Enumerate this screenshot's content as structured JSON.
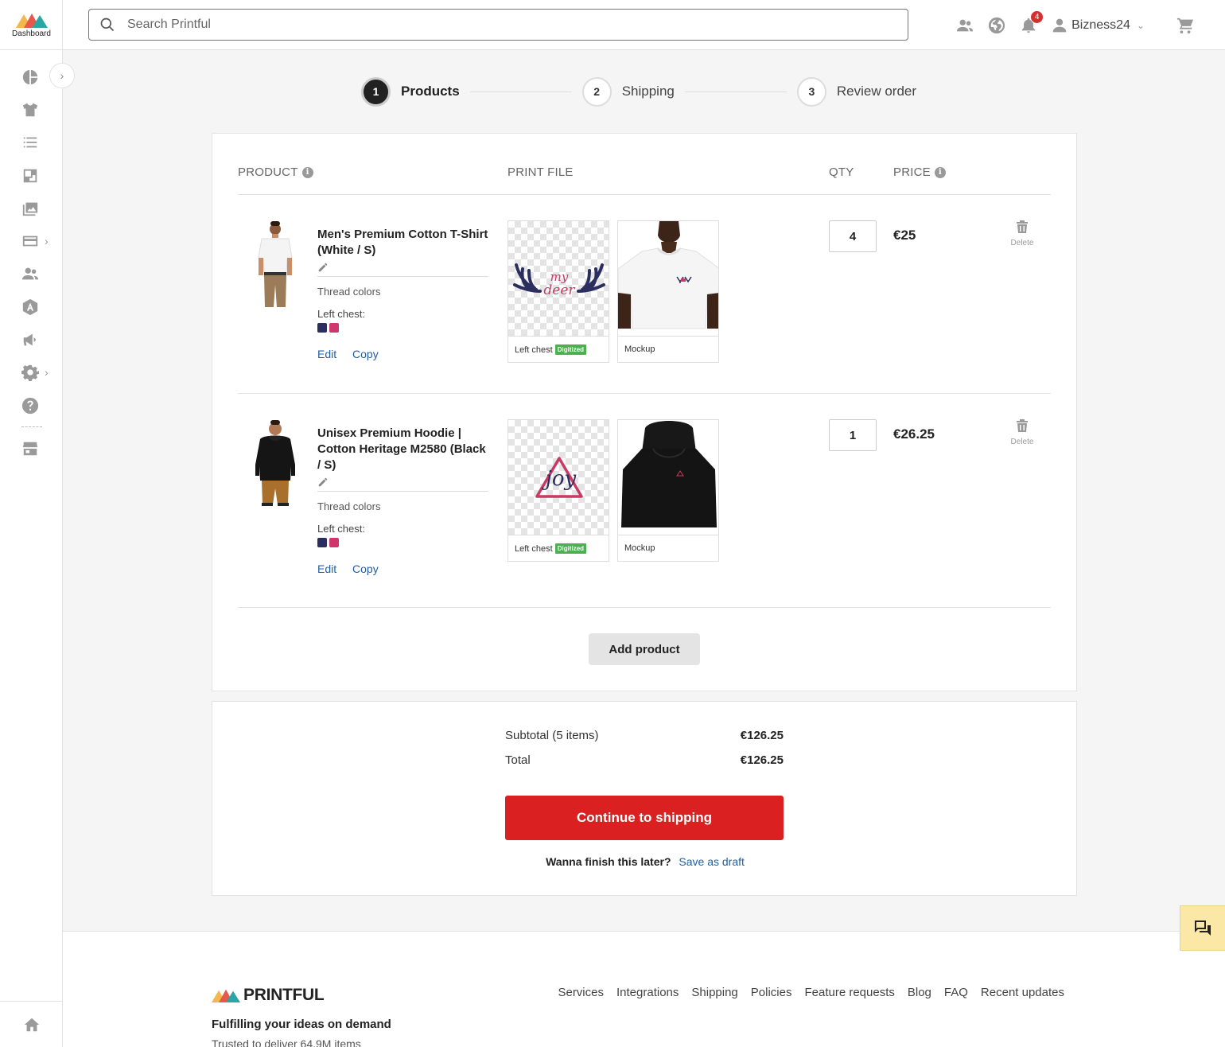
{
  "app": {
    "logo_label": "Dashboard"
  },
  "search": {
    "placeholder": "Search Printful"
  },
  "topbar": {
    "notification_count": "4",
    "user_name": "Bizness24"
  },
  "stepper": {
    "steps": [
      {
        "num": "1",
        "label": "Products"
      },
      {
        "num": "2",
        "label": "Shipping"
      },
      {
        "num": "3",
        "label": "Review order"
      }
    ]
  },
  "table": {
    "headers": {
      "product": "PRODUCT",
      "print_file": "PRINT FILE",
      "qty": "QTY",
      "price": "PRICE"
    }
  },
  "items": [
    {
      "name": "Men's Premium Cotton T-Shirt (White / S)",
      "thread_colors": "Thread colors",
      "placement": "Left chest:",
      "swatches": [
        "#2b2e5e",
        "#d0356b"
      ],
      "edit": "Edit",
      "copy": "Copy",
      "print_caption": "Left chest",
      "digitized": "Digitized",
      "mockup_caption": "Mockup",
      "qty": "4",
      "price": "€25",
      "delete": "Delete"
    },
    {
      "name": "Unisex Premium Hoodie | Cotton Heritage M2580 (Black / S)",
      "thread_colors": "Thread colors",
      "placement": "Left chest:",
      "swatches": [
        "#2b2e5e",
        "#d0356b"
      ],
      "edit": "Edit",
      "copy": "Copy",
      "print_caption": "Left chest",
      "digitized": "Digitized",
      "mockup_caption": "Mockup",
      "qty": "1",
      "price": "€26.25",
      "delete": "Delete"
    }
  ],
  "add_product": "Add product",
  "summary": {
    "subtotal_label": "Subtotal (5 items)",
    "subtotal_value": "€126.25",
    "total_label": "Total",
    "total_value": "€126.25",
    "continue": "Continue to shipping",
    "later_q": "Wanna finish this later?",
    "later_a": "Save as draft"
  },
  "footer": {
    "brand": "PRINTFUL",
    "tagline": "Fulfilling your ideas on demand",
    "sub": "Trusted to deliver 64.9M items",
    "links": [
      "Services",
      "Integrations",
      "Shipping",
      "Policies",
      "Feature requests",
      "Blog",
      "FAQ",
      "Recent updates"
    ]
  },
  "colors": {
    "accent": "#da2020",
    "link": "#1e5fa8",
    "digitized": "#4caf50"
  }
}
